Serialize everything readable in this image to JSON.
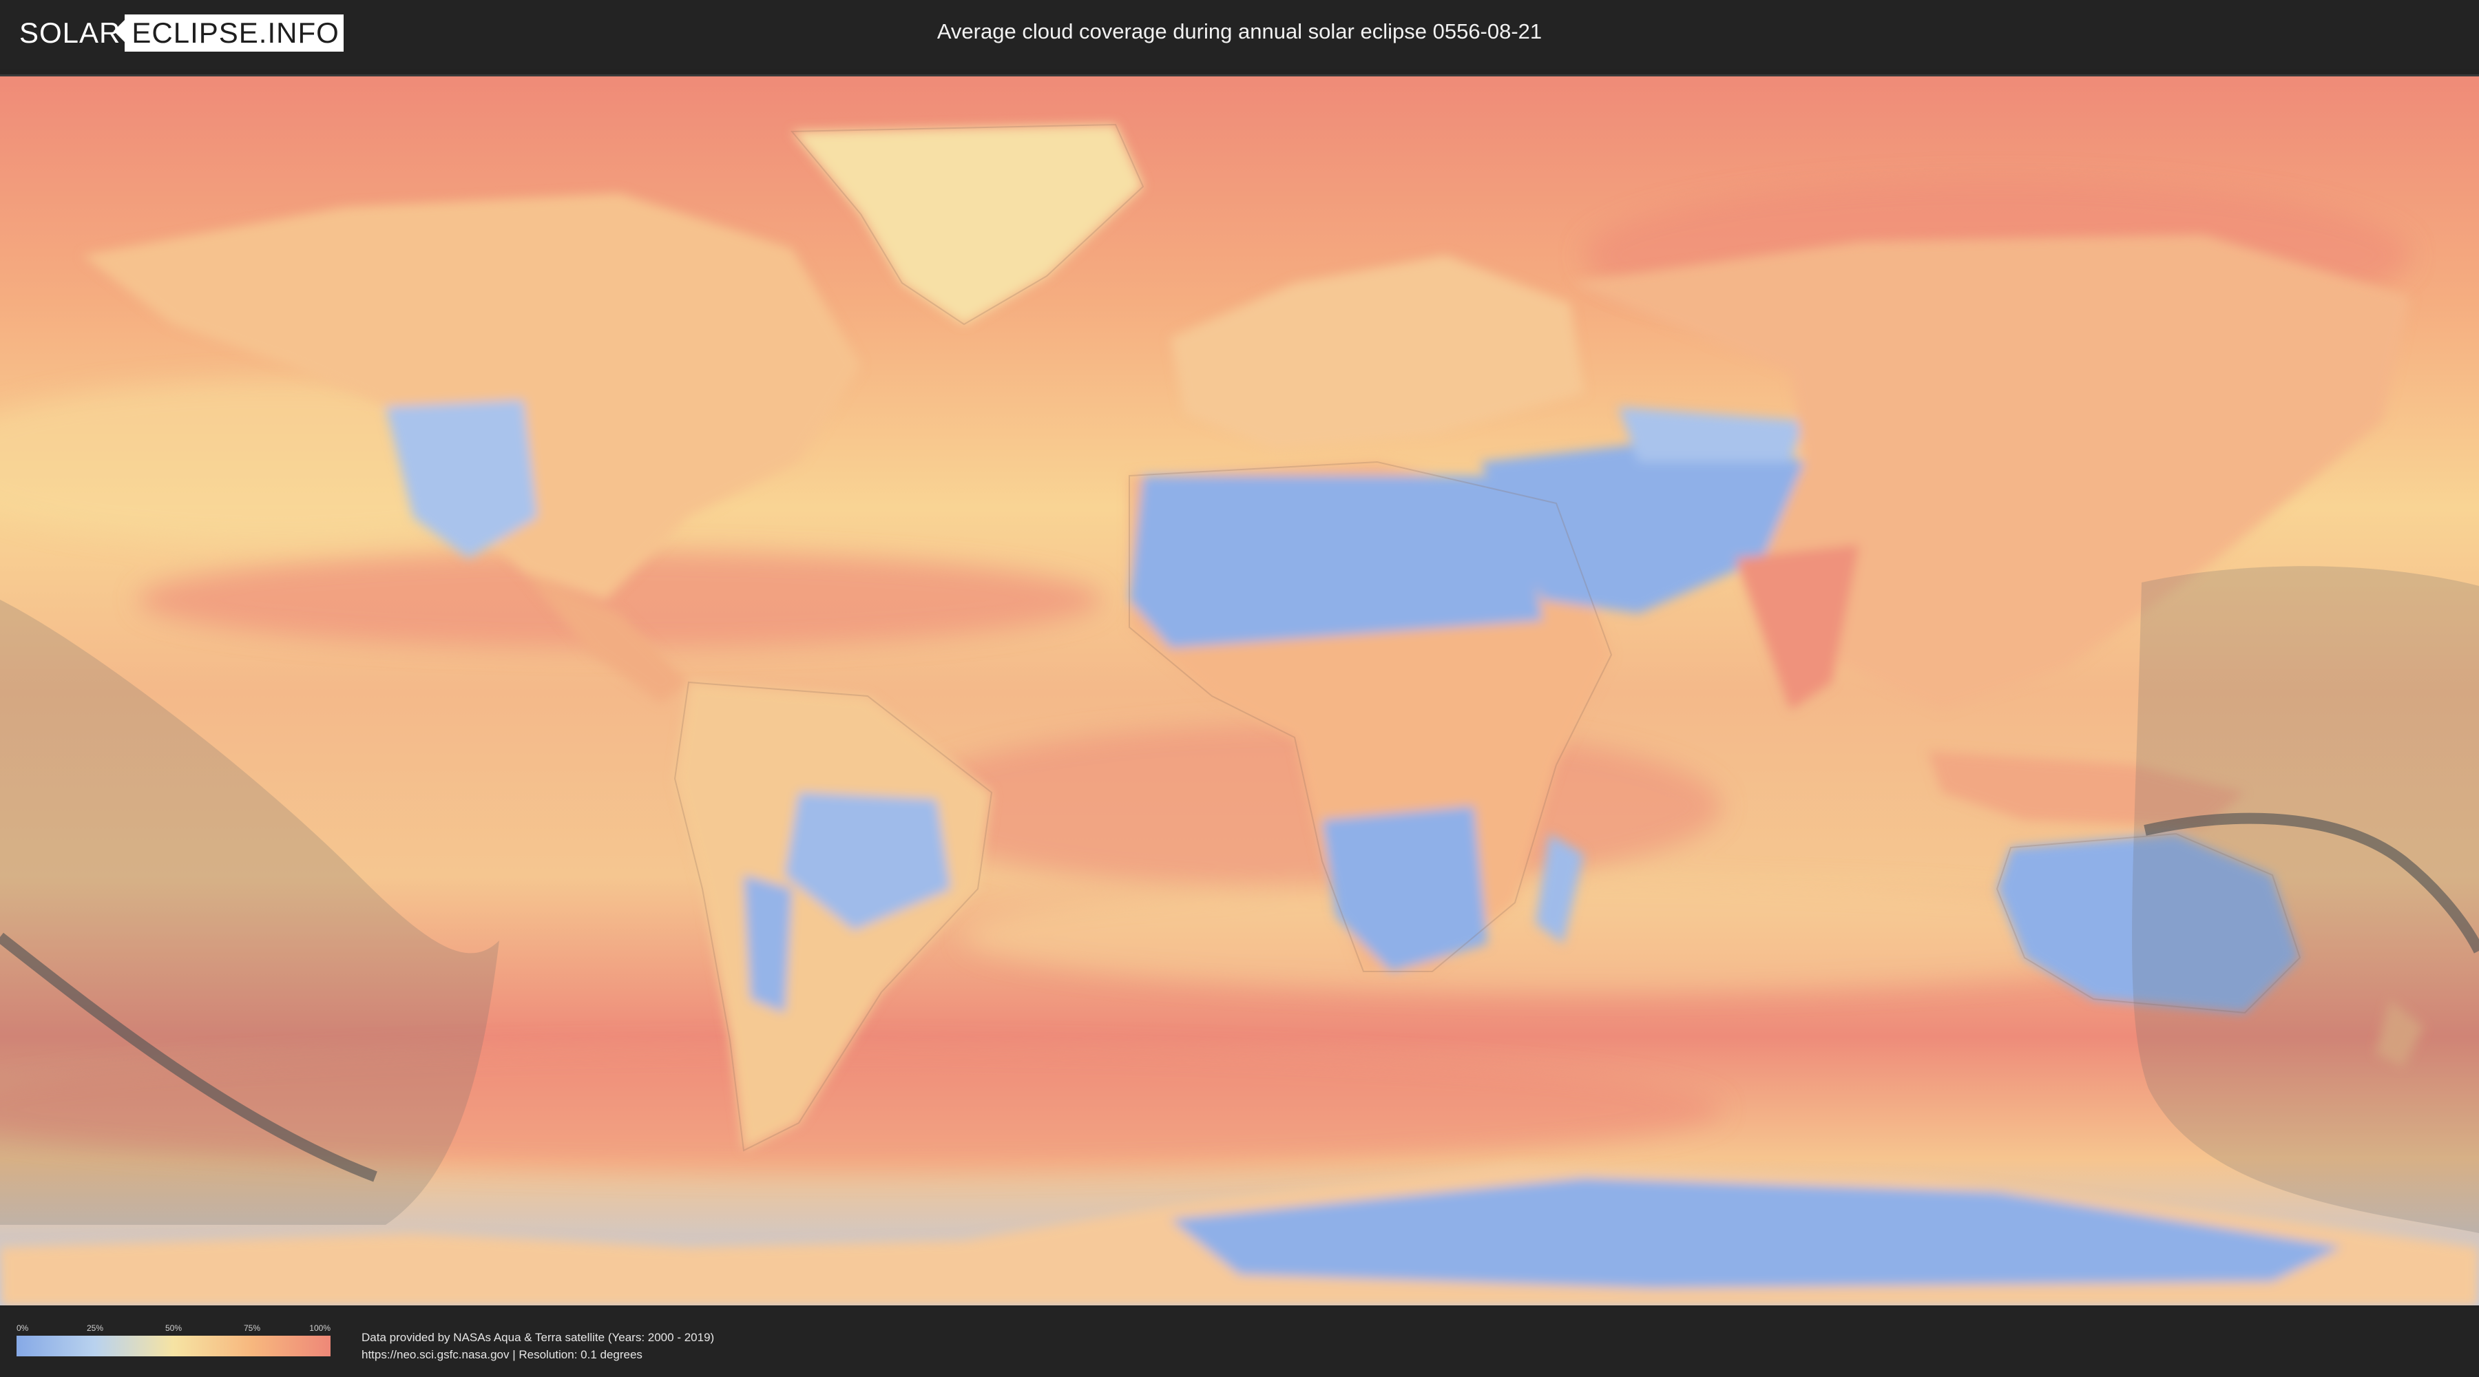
{
  "header": {
    "logo_solar": "SOLAR",
    "logo_eclipse": "ECLIPSE.INFO",
    "title": "Average cloud coverage during annual solar eclipse 0556-08-21"
  },
  "map": {
    "colors": {
      "clear": "#86a9e6",
      "light": "#b9d2ee",
      "mid": "#f6e3a3",
      "heavy": "#f7b77e",
      "overcast": "#ee8878",
      "eclipse_shadow": "#6b6b6b",
      "central_path": "#555555"
    }
  },
  "legend": {
    "ticks": [
      "0%",
      "25%",
      "50%",
      "75%",
      "100%"
    ]
  },
  "footer": {
    "credit_line_1": "Data provided by NASAs Aqua & Terra satellite (Years: 2000 - 2019)",
    "credit_line_2": "https://neo.sci.gsfc.nasa.gov | Resolution: 0.1 degrees"
  }
}
